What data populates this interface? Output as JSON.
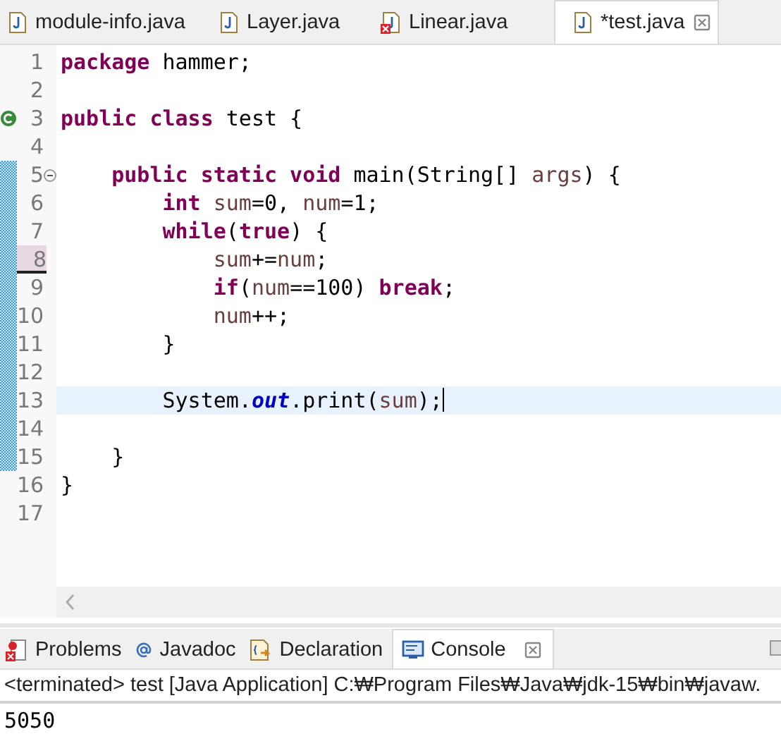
{
  "editor_tabs": [
    {
      "label": "module-info.java",
      "selected": false,
      "error": false
    },
    {
      "label": "Layer.java",
      "selected": false,
      "error": false
    },
    {
      "label": "Linear.java",
      "selected": false,
      "error": true
    },
    {
      "label": "*test.java",
      "selected": true,
      "error": false
    }
  ],
  "editor": {
    "lines": [
      {
        "number": "1",
        "kind": "statement",
        "current": false,
        "changed": false,
        "highlighted": false,
        "tokens": [
          {
            "kind": "keyword",
            "text": "package"
          },
          {
            "kind": "plain",
            "text": " hammer;"
          }
        ]
      },
      {
        "number": "2",
        "kind": "blank",
        "current": false,
        "changed": false,
        "highlighted": false
      },
      {
        "number": "3",
        "kind": "class",
        "current": false,
        "changed": false,
        "highlighted": false,
        "tokens": [
          {
            "kind": "keyword",
            "text": "public"
          },
          {
            "kind": "keyword",
            "text": " class"
          },
          {
            "kind": "plain",
            "text": " test {"
          }
        ]
      },
      {
        "number": "4",
        "kind": "blank",
        "current": false,
        "changed": false,
        "highlighted": false
      },
      {
        "number": "5",
        "kind": "method",
        "current": false,
        "changed": true,
        "highlighted": false,
        "tokens": [
          {
            "kind": "keyword",
            "text": "    public"
          },
          {
            "kind": "keyword",
            "text": " static"
          },
          {
            "kind": "keyword",
            "text": " void"
          },
          {
            "kind": "plain",
            "text": " main(String[] "
          },
          {
            "kind": "variable",
            "text": "args"
          },
          {
            "kind": "plain",
            "text": ") {"
          }
        ]
      },
      {
        "number": "6",
        "kind": "statement",
        "current": false,
        "changed": true,
        "highlighted": false,
        "tokens": [
          {
            "kind": "keyword",
            "text": "        int"
          },
          {
            "kind": "variable",
            "text": " sum"
          },
          {
            "kind": "plain",
            "text": "=0, "
          },
          {
            "kind": "variable",
            "text": "num"
          },
          {
            "kind": "plain",
            "text": "=1;"
          }
        ]
      },
      {
        "number": "7",
        "kind": "statement",
        "current": false,
        "changed": true,
        "highlighted": false,
        "tokens": [
          {
            "kind": "keyword",
            "text": "        while"
          },
          {
            "kind": "plain",
            "text": "("
          },
          {
            "kind": "keyword",
            "text": "true"
          },
          {
            "kind": "plain",
            "text": ") {"
          }
        ]
      },
      {
        "number": "8",
        "kind": "statement",
        "current": false,
        "changed": true,
        "highlighted": true,
        "tokens": [
          {
            "kind": "variable",
            "text": "            sum"
          },
          {
            "kind": "plain",
            "text": "+="
          },
          {
            "kind": "variable",
            "text": "num"
          },
          {
            "kind": "plain",
            "text": ";"
          }
        ]
      },
      {
        "number": "9",
        "kind": "statement",
        "current": false,
        "changed": true,
        "highlighted": false,
        "tokens": [
          {
            "kind": "keyword",
            "text": "            if"
          },
          {
            "kind": "plain",
            "text": "("
          },
          {
            "kind": "variable",
            "text": "num"
          },
          {
            "kind": "plain",
            "text": "==100) "
          },
          {
            "kind": "keyword",
            "text": "break"
          },
          {
            "kind": "plain",
            "text": ";"
          }
        ]
      },
      {
        "number": "10",
        "kind": "statement",
        "current": false,
        "changed": true,
        "highlighted": false,
        "tokens": [
          {
            "kind": "variable",
            "text": "            num"
          },
          {
            "kind": "plain",
            "text": "++;"
          }
        ]
      },
      {
        "number": "11",
        "kind": "statement",
        "current": false,
        "changed": true,
        "highlighted": false,
        "tokens": [
          {
            "kind": "plain",
            "text": "        }"
          }
        ]
      },
      {
        "number": "12",
        "kind": "blank",
        "current": false,
        "changed": true,
        "highlighted": false
      },
      {
        "number": "13",
        "kind": "statement",
        "current": true,
        "changed": true,
        "highlighted": false,
        "tokens": [
          {
            "kind": "plain",
            "text": "        System."
          },
          {
            "kind": "field",
            "text": "out"
          },
          {
            "kind": "plain",
            "text": ".print("
          },
          {
            "kind": "variable",
            "text": "sum"
          },
          {
            "kind": "plain",
            "text": ");"
          }
        ]
      },
      {
        "number": "14",
        "kind": "blank",
        "current": false,
        "changed": true,
        "highlighted": false
      },
      {
        "number": "15",
        "kind": "statement",
        "current": false,
        "changed": true,
        "highlighted": false,
        "tokens": [
          {
            "kind": "plain",
            "text": "    }"
          }
        ]
      },
      {
        "number": "16",
        "kind": "statement",
        "current": false,
        "changed": false,
        "highlighted": false,
        "tokens": [
          {
            "kind": "plain",
            "text": "}"
          }
        ]
      },
      {
        "number": "17",
        "kind": "blank",
        "current": false,
        "changed": false,
        "highlighted": false
      }
    ]
  },
  "panel_tabs": [
    {
      "kind": "problems",
      "label": "Problems",
      "selected": false
    },
    {
      "kind": "javadoc",
      "label": "Javadoc",
      "selected": false
    },
    {
      "kind": "declaration",
      "label": "Declaration",
      "selected": false
    },
    {
      "kind": "console",
      "label": "Console",
      "selected": true
    }
  ],
  "console": {
    "header": "<terminated> test [Java Application] C:₩Program Files₩Java₩jdk-15₩bin₩javaw.",
    "output": "5050"
  }
}
